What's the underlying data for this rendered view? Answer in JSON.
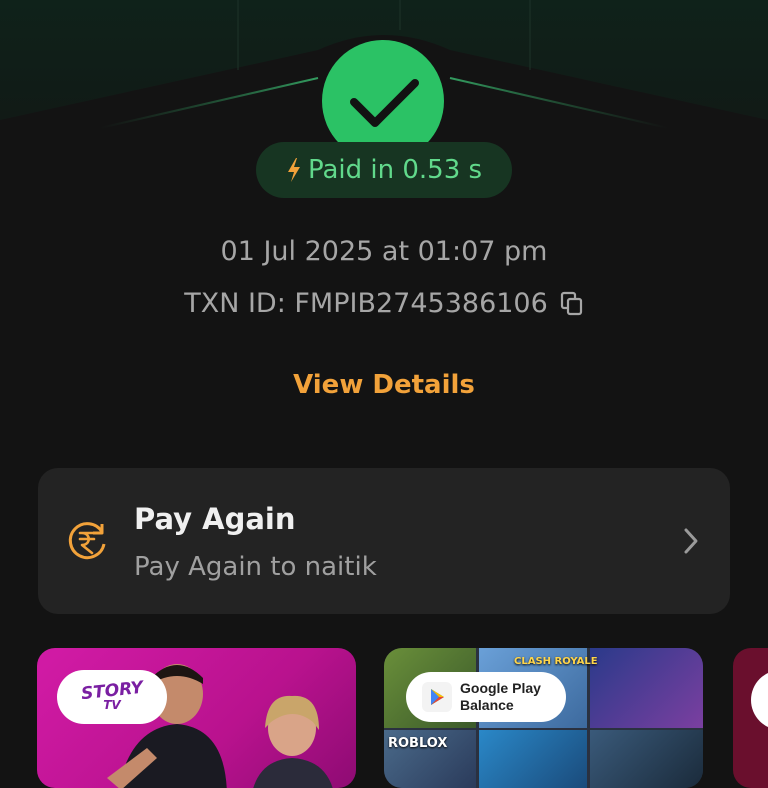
{
  "status": {
    "paid_text": "Paid in 0.53 s",
    "date_time": "01 Jul 2025 at 01:07 pm",
    "txn_id": "TXN ID: FMPIB2745386106",
    "view_details": "View Details"
  },
  "pay_again": {
    "title": "Pay Again",
    "subtitle": "Pay Again to naitik"
  },
  "banners": {
    "story_tv": {
      "logo": "STORY",
      "logo_sub": "TV"
    },
    "google_play": {
      "line1": "Google Play",
      "line2": "Balance",
      "tiles": [
        "CLASH ROYALE",
        "ROBLOX"
      ]
    }
  },
  "colors": {
    "success_green": "#2bc265",
    "pill_bg": "#173522",
    "pill_text": "#61d98b",
    "accent_orange": "#f2a23a",
    "card_bg": "#232323",
    "background": "#131313"
  }
}
